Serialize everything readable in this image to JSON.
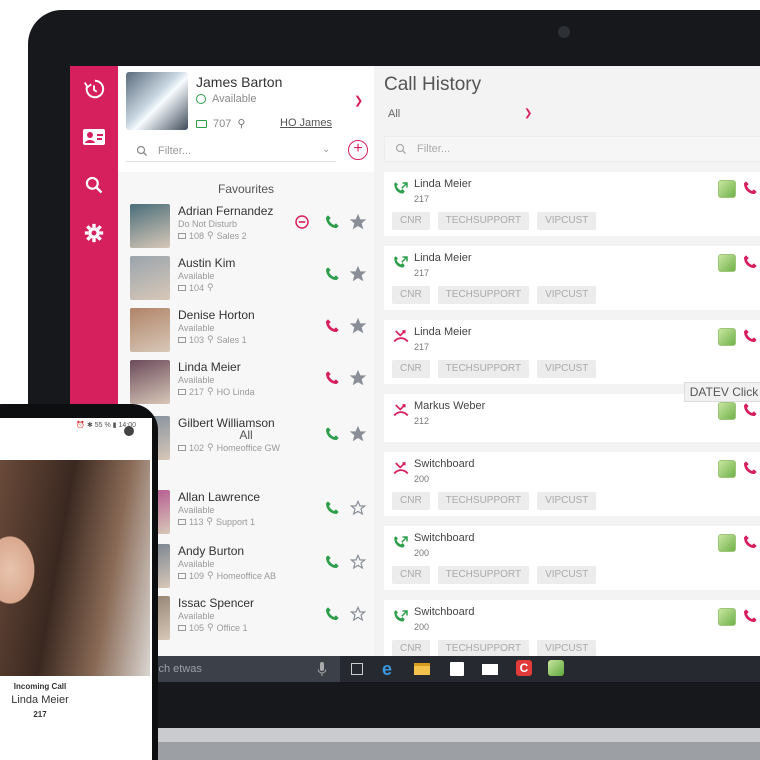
{
  "me": {
    "name": "James Barton",
    "status": "Available",
    "extension": "707",
    "location": "HO James"
  },
  "left_filter_placeholder": "Filter...",
  "sections": {
    "favourites": "Favourites",
    "all": "All"
  },
  "contacts": [
    {
      "name": "Adrian Fernandez",
      "status": "Do Not Disturb",
      "extension": "108",
      "location": "Sales 2",
      "favourite": true,
      "dnd": true
    },
    {
      "name": "Austin Kim",
      "status": "Available",
      "extension": "104",
      "location": "",
      "favourite": true
    },
    {
      "name": "Denise Horton",
      "status": "Available",
      "extension": "103",
      "location": "Sales 1",
      "favourite": true
    },
    {
      "name": "Linda Meier",
      "status": "Available",
      "extension": "217",
      "location": "HO Linda",
      "favourite": true
    },
    {
      "name": "Gilbert Williamson",
      "status": "",
      "extension": "102",
      "location": "Homeoffice GW",
      "favourite": true
    },
    {
      "name": "Allan Lawrence",
      "status": "Available",
      "extension": "113",
      "location": "Support 1",
      "favourite": false
    },
    {
      "name": "Andy Burton",
      "status": "Available",
      "extension": "109",
      "location": "Homeoffice AB",
      "favourite": false
    },
    {
      "name": "Issac Spencer",
      "status": "Available",
      "extension": "105",
      "location": "Office 1",
      "favourite": false
    }
  ],
  "call_history": {
    "title": "Call History",
    "filter_value": "All",
    "search_placeholder": "Filter...",
    "tooltip": "DATEV Click",
    "entries": [
      {
        "name": "Linda Meier",
        "number": "217",
        "type": "outgoing",
        "tags": [
          "CNR",
          "TECHSUPPORT",
          "VIPCUST"
        ]
      },
      {
        "name": "Linda Meier",
        "number": "217",
        "type": "outgoing",
        "tags": [
          "CNR",
          "TECHSUPPORT",
          "VIPCUST"
        ]
      },
      {
        "name": "Linda Meier",
        "number": "217",
        "type": "missed",
        "tags": [
          "CNR",
          "TECHSUPPORT",
          "VIPCUST"
        ]
      },
      {
        "name": "Markus Weber",
        "number": "212",
        "type": "missed",
        "tags": []
      },
      {
        "name": "Switchboard",
        "number": "200",
        "type": "missed",
        "tags": [
          "CNR",
          "TECHSUPPORT",
          "VIPCUST"
        ]
      },
      {
        "name": "Switchboard",
        "number": "200",
        "type": "outgoing",
        "tags": [
          "CNR",
          "TECHSUPPORT",
          "VIPCUST"
        ]
      },
      {
        "name": "Switchboard",
        "number": "200",
        "type": "outgoing",
        "tags": [
          "CNR",
          "TECHSUPPORT",
          "VIPCUST"
        ]
      }
    ],
    "time_prefix": "1"
  },
  "taskbar": {
    "search_text": "ich etwas"
  },
  "phone": {
    "status_bar": "⏰ ✱ 55 % ▮ 14:00",
    "incoming_label": "Incoming Call",
    "caller": "Linda Meier",
    "caller_number": "217"
  },
  "colors": {
    "accent": "#d6205d",
    "green": "#2e9e4b",
    "red": "#d6205d"
  }
}
